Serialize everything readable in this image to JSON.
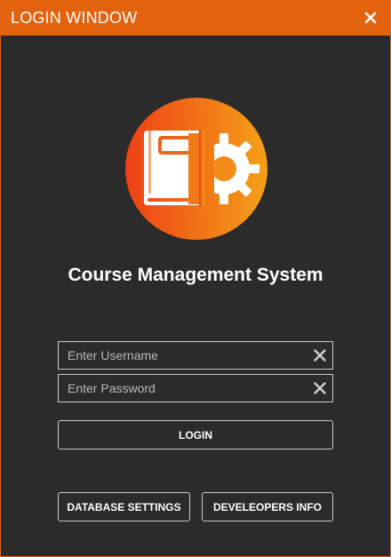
{
  "window": {
    "title": "LOGIN WINDOW",
    "accent_color": "#e2620e",
    "background_color": "#2b2b2b",
    "close_icon": "close-icon"
  },
  "logo": {
    "icon": "book-gear-logo",
    "gradient": [
      "#ee4015",
      "#f4a118"
    ]
  },
  "app": {
    "title": "Course Management System"
  },
  "form": {
    "username_placeholder": "Enter Username",
    "username_value": "",
    "password_placeholder": "Enter Password",
    "password_value": "",
    "clear_icon": "clear-icon",
    "login_label": "LOGIN"
  },
  "footer": {
    "database_settings_label": "DATABASE SETTINGS",
    "developers_info_label": "DEVELEOPERS INFO"
  }
}
